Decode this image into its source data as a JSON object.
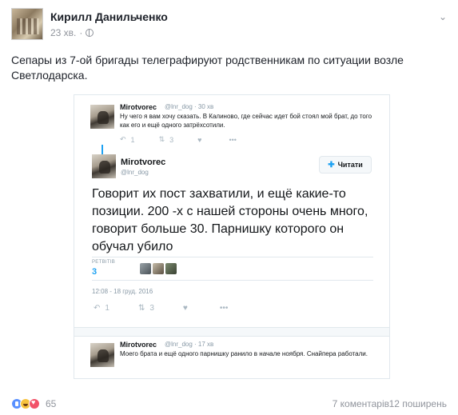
{
  "post": {
    "author": "Кирилл Данильченко",
    "time": "23 хв.",
    "separator": "·",
    "text": "Сепары из 7-ой бригады телеграфируют родственникам по ситуации возле Светлодарска."
  },
  "screenshot": {
    "reply_tweet": {
      "name": "Mirotvorec",
      "handle": "@lnr_dog · 30 хв",
      "text": "Ну чего я вам хочу сказать. В Калиново, где сейчас идет бой стоял мой брат, до того как его и ещё одного затрёхсотили.",
      "reply_count": "1",
      "retweet_count": "3"
    },
    "main_tweet": {
      "name": "Mirotvorec",
      "handle": "@lnr_dog",
      "follow_label": "Читати",
      "text": "Говорит их пост захватили, и ещё какие-то позиции. 200 -х  с нашей стороны очень много, говорит больше 30. Парнишку которого он обучал убило",
      "retweets_label": "РЕТВІТІВ",
      "retweets_count": "3",
      "date": "12:08 - 18 груд. 2016",
      "reply_count": "1",
      "retweet_count": "3"
    },
    "next_tweet": {
      "name": "Mirotvorec",
      "handle": "@lnr_dog · 17 хв",
      "text": "Моего брата и ещё одного парнишку ранило в начале ноября. Снайпера работали."
    }
  },
  "footer": {
    "reaction_count": "65",
    "comments": "7 коментарів",
    "shares": "12 поширень"
  },
  "colors": {
    "twitter_blue": "#1da1f2",
    "fb_like_blue": "#5890ff",
    "muted": "#90949c"
  }
}
